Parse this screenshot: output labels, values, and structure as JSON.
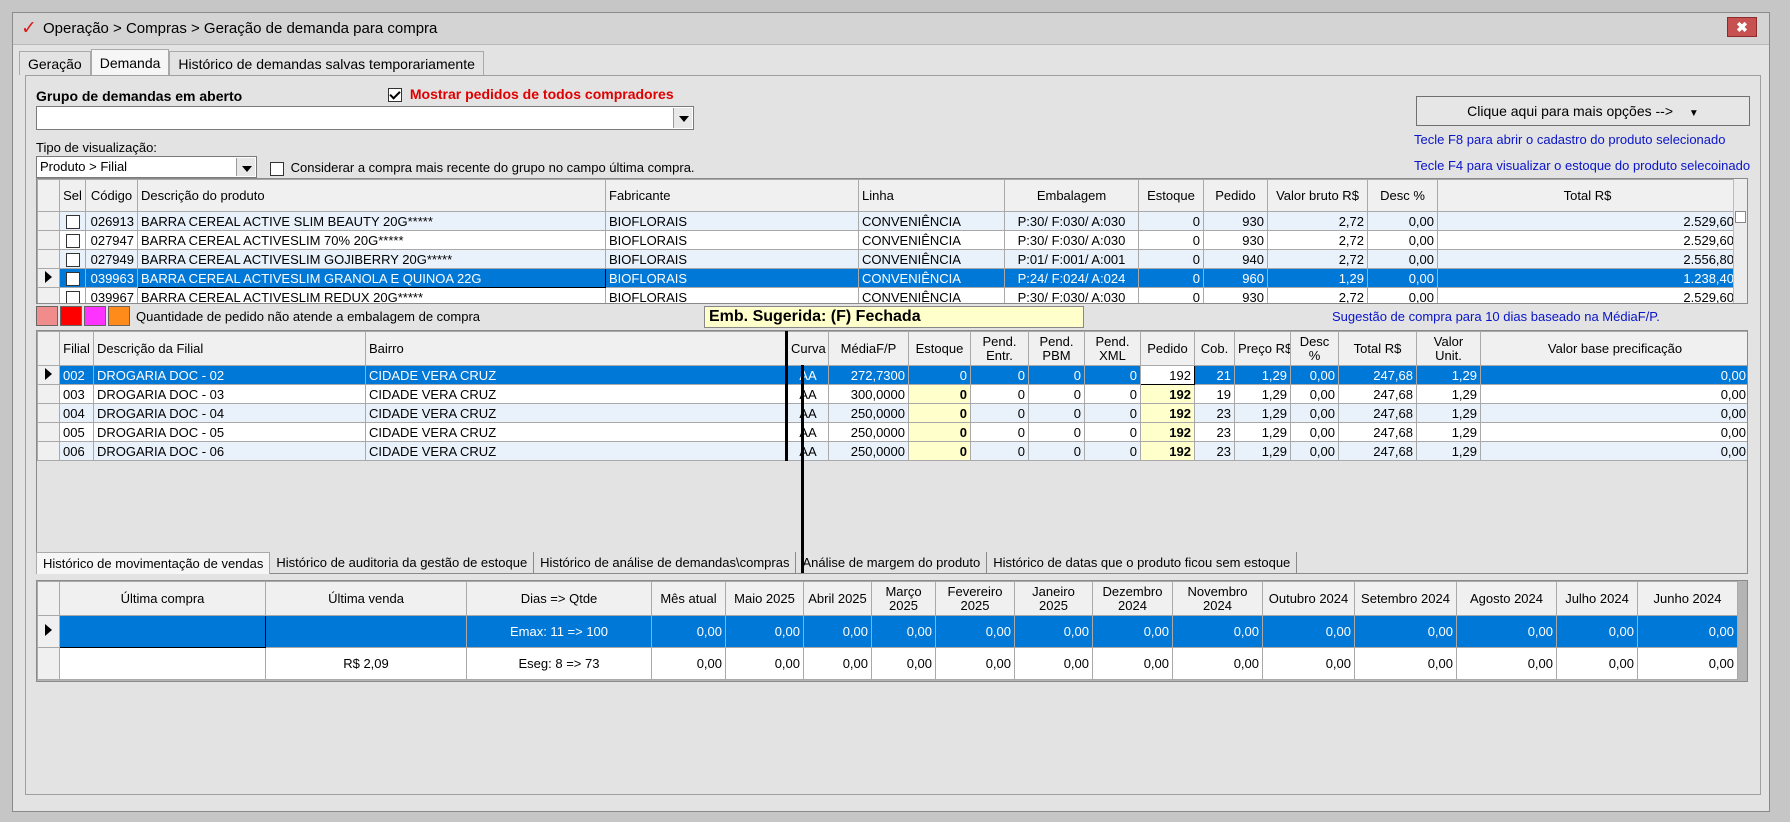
{
  "window": {
    "title": "Operação > Compras > Geração de demanda para compra",
    "close_label": "✖"
  },
  "main_tabs": [
    "Geração",
    "Demanda",
    "Histórico de demandas salvas temporariamente"
  ],
  "grupo": {
    "label": "Grupo de demandas em aberto",
    "value": ""
  },
  "mostrar_pedidos": {
    "label": "Mostrar pedidos de todos compradores",
    "checked": true
  },
  "tipo_visualizacao": {
    "label": "Tipo de visualização:",
    "value": "Produto > Filial"
  },
  "considerar": {
    "label": "Considerar a compra mais recente do grupo no campo última compra.",
    "checked": false
  },
  "options_button": "Clique aqui para mais opções -->",
  "hints": [
    "Tecle F8 para abrir o cadastro do produto selecionado",
    "Tecle F4 para visualizar o estoque do produto selecoinado"
  ],
  "products": {
    "headers": [
      "Sel",
      "Código",
      "Descrição do produto",
      "Fabricante",
      "Linha",
      "Embalagem",
      "Estoque",
      "Pedido",
      "Valor bruto R$",
      "Desc %",
      "Total R$"
    ],
    "rows": [
      {
        "codigo": "026913",
        "descricao": "BARRA CEREAL ACTIVE SLIM BEAUTY 20G*****",
        "fabricante": "BIOFLORAIS",
        "linha": "CONVENIÊNCIA",
        "embalagem": "P:30/ F:030/ A:030",
        "estoque": "0",
        "pedido": "930",
        "valor": "2,72",
        "desc": "0,00",
        "total": "2.529,60"
      },
      {
        "codigo": "027947",
        "descricao": "BARRA CEREAL ACTIVESLIM 70% 20G*****",
        "fabricante": "BIOFLORAIS",
        "linha": "CONVENIÊNCIA",
        "embalagem": "P:30/ F:030/ A:030",
        "estoque": "0",
        "pedido": "930",
        "valor": "2,72",
        "desc": "0,00",
        "total": "2.529,60"
      },
      {
        "codigo": "027949",
        "descricao": "BARRA CEREAL ACTIVESLIM GOJIBERRY 20G*****",
        "fabricante": "BIOFLORAIS",
        "linha": "CONVENIÊNCIA",
        "embalagem": "P:01/ F:001/ A:001",
        "estoque": "0",
        "pedido": "940",
        "valor": "2,72",
        "desc": "0,00",
        "total": "2.556,80"
      },
      {
        "codigo": "039963",
        "descricao": "BARRA CEREAL ACTIVESLIM GRANOLA E QUINOA 22G",
        "fabricante": "BIOFLORAIS",
        "linha": "CONVENIÊNCIA",
        "embalagem": "P:24/ F:024/ A:024",
        "estoque": "0",
        "pedido": "960",
        "valor": "1,29",
        "desc": "0,00",
        "total": "1.238,40"
      },
      {
        "codigo": "039967",
        "descricao": "BARRA CEREAL ACTIVESLIM REDUX 20G*****",
        "fabricante": "BIOFLORAIS",
        "linha": "CONVENIÊNCIA",
        "embalagem": "P:30/ F:030/ A:030",
        "estoque": "0",
        "pedido": "930",
        "valor": "2,72",
        "desc": "0,00",
        "total": "2.529,60"
      }
    ]
  },
  "legend": {
    "colors": [
      "#f08c8c",
      "#ff0000",
      "#ff33ff",
      "#ff8c1a"
    ],
    "text": "Quantidade de pedido não atende a embalagem de compra"
  },
  "emb_sugerida": "Emb. Sugerida: (F) Fechada",
  "sugestao": "Sugestão de compra para 10 dias baseado na MédiaF/P.",
  "branches": {
    "headers": [
      "Filial",
      "Descrição da Filial",
      "Bairro",
      "Curva",
      "MédiaF/P",
      "Estoque",
      "Pend. Entr.",
      "Pend. PBM",
      "Pend. XML",
      "Pedido",
      "Cob.",
      "Preço R$",
      "Desc %",
      "Total R$",
      "Valor Unit.",
      "Valor base precificação"
    ],
    "rows": [
      {
        "filial": "002",
        "descricao": "DROGARIA DOC - 02",
        "bairro": "CIDADE VERA CRUZ",
        "curva": "AA",
        "media": "272,7300",
        "estoque": "0",
        "entr": "0",
        "pbm": "0",
        "xml": "0",
        "pedido": "192",
        "cob": "21",
        "preco": "1,29",
        "desc": "0,00",
        "total": "247,68",
        "unit": "1,29",
        "base": "0,00"
      },
      {
        "filial": "003",
        "descricao": "DROGARIA DOC - 03",
        "bairro": "CIDADE VERA CRUZ",
        "curva": "AA",
        "media": "300,0000",
        "estoque": "0",
        "entr": "0",
        "pbm": "0",
        "xml": "0",
        "pedido": "192",
        "cob": "19",
        "preco": "1,29",
        "desc": "0,00",
        "total": "247,68",
        "unit": "1,29",
        "base": "0,00"
      },
      {
        "filial": "004",
        "descricao": "DROGARIA DOC - 04",
        "bairro": "CIDADE VERA CRUZ",
        "curva": "AA",
        "media": "250,0000",
        "estoque": "0",
        "entr": "0",
        "pbm": "0",
        "xml": "0",
        "pedido": "192",
        "cob": "23",
        "preco": "1,29",
        "desc": "0,00",
        "total": "247,68",
        "unit": "1,29",
        "base": "0,00"
      },
      {
        "filial": "005",
        "descricao": "DROGARIA DOC - 05",
        "bairro": "CIDADE VERA CRUZ",
        "curva": "AA",
        "media": "250,0000",
        "estoque": "0",
        "entr": "0",
        "pbm": "0",
        "xml": "0",
        "pedido": "192",
        "cob": "23",
        "preco": "1,29",
        "desc": "0,00",
        "total": "247,68",
        "unit": "1,29",
        "base": "0,00"
      },
      {
        "filial": "006",
        "descricao": "DROGARIA DOC - 06",
        "bairro": "CIDADE VERA CRUZ",
        "curva": "AA",
        "media": "250,0000",
        "estoque": "0",
        "entr": "0",
        "pbm": "0",
        "xml": "0",
        "pedido": "192",
        "cob": "23",
        "preco": "1,29",
        "desc": "0,00",
        "total": "247,68",
        "unit": "1,29",
        "base": "0,00"
      }
    ]
  },
  "history_tabs": [
    "Histórico de movimentação de vendas",
    "Histórico de auditoria da gestão de estoque",
    "Histórico de análise de demandas\\compras",
    "Análise de margem do produto",
    "Histórico de datas que o produto ficou sem estoque"
  ],
  "history": {
    "headers": [
      "Última compra",
      "Última venda",
      "Dias => Qtde",
      "Mês atual",
      "Maio 2025",
      "Abril 2025",
      "Março 2025",
      "Fevereiro 2025",
      "Janeiro 2025",
      "Dezembro 2024",
      "Novembro 2024",
      "Outubro 2024",
      "Setembro 2024",
      "Agosto 2024",
      "Julho 2024",
      "Junho 2024"
    ],
    "rows": [
      [
        "",
        "",
        "Emax: 11 => 100",
        "0,00",
        "0,00",
        "0,00",
        "0,00",
        "0,00",
        "0,00",
        "0,00",
        "0,00",
        "0,00",
        "0,00",
        "0,00",
        "0,00",
        "0,00"
      ],
      [
        "",
        "R$ 2,09",
        "Eseg: 8 => 73",
        "0,00",
        "0,00",
        "0,00",
        "0,00",
        "0,00",
        "0,00",
        "0,00",
        "0,00",
        "0,00",
        "0,00",
        "0,00",
        "0,00",
        "0,00"
      ]
    ]
  }
}
